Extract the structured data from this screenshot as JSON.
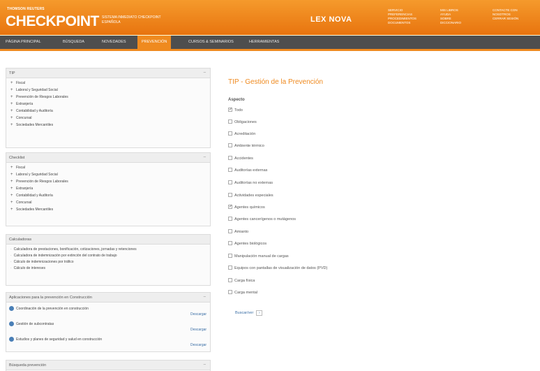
{
  "header": {
    "brand_small": "THOMSON REUTERS",
    "brand": "CHECKPOINT",
    "subtitle_line1": "SISTEMA INMEDIATO CHECKPOINT",
    "subtitle_line2": "ESPAÑOLA",
    "product": "LEX NOVA",
    "links": [
      [
        "SERVICIO",
        "PREFERENCIAS",
        "PROCEDIMIENTOS",
        "DOCUMENTOS"
      ],
      [
        "MIS LIBROS",
        "AYUDA",
        "SOBRE",
        "DICCIONARIO"
      ],
      [
        "CONTACTE CON",
        "NOSOTROS",
        "CERRAR SESIÓN"
      ]
    ]
  },
  "nav": {
    "tabs": [
      "PÁGINA PRINCIPAL",
      "BÚSQUEDA",
      "NOVEDADES",
      "PREVENCIÓN",
      "CURSOS & SEMINARIOS",
      "HERRAMIENTAS"
    ],
    "active_index": 3
  },
  "left": {
    "tip": {
      "title": "TIP",
      "items": [
        "Fiscal",
        "Laboral y Seguridad Social",
        "Prevención de Riesgos Laborales",
        "Extranjería",
        "Contabilidad y Auditoría",
        "Concursal",
        "Sociedades Mercantiles"
      ]
    },
    "checklist": {
      "title": "Checklist",
      "items": [
        "Fiscal",
        "Laboral y Seguridad Social",
        "Prevención de Riesgos Laborales",
        "Extranjería",
        "Contabilidad y Auditoría",
        "Concursal",
        "Sociedades Mercantiles"
      ]
    },
    "calculadoras": {
      "title": "Calculadoras",
      "items": [
        "Calculadora de prestaciones, bonificación, cotizaciones, jornadas y retenciones",
        "Calculadora de indemnización por extinción del contrato de trabajo",
        "Cálculo de indemnizaciones por tráfico",
        "Cálculo de intereses"
      ]
    },
    "aplicaciones": {
      "title": "Aplicaciones para la prevención en Construcción",
      "items": [
        {
          "label": "Coordinación de la prevención en construcción",
          "link": "Descargar"
        },
        {
          "label": "Gestión de subcontratas",
          "link": "Descargar"
        },
        {
          "label": "Estudios y planes de seguridad y salud en construcción",
          "link": "Descargar"
        }
      ]
    },
    "buscador": {
      "title": "Búsqueda prevención"
    }
  },
  "main": {
    "title": "TIP - Gestión de la Prevención",
    "section_label": "Aspecto",
    "options": [
      {
        "label": "Todo",
        "checked": true
      },
      {
        "label": "Obligaciones",
        "checked": false
      },
      {
        "label": "Acreditación",
        "checked": false
      },
      {
        "label": "Ambiente térmico",
        "checked": false
      },
      {
        "label": "Accidentes",
        "checked": false
      },
      {
        "label": "Auditorías externas",
        "checked": false
      },
      {
        "label": "Auditorías no externas",
        "checked": false
      },
      {
        "label": "Actividades especiales",
        "checked": false
      },
      {
        "label": "Agentes químicos",
        "checked": true
      },
      {
        "label": "Agentes cancerígenos o mutágenos",
        "checked": false
      },
      {
        "label": "Amianto",
        "checked": false
      },
      {
        "label": "Agentes biológicos",
        "checked": false
      },
      {
        "label": "Manipulación manual de cargas",
        "checked": false
      },
      {
        "label": "Equipos con pantallas de visualización de datos (PVD)",
        "checked": false
      },
      {
        "label": "Carga física",
        "checked": false
      },
      {
        "label": "Carga mental",
        "checked": false
      }
    ],
    "search_button": "Buscar/ver"
  }
}
